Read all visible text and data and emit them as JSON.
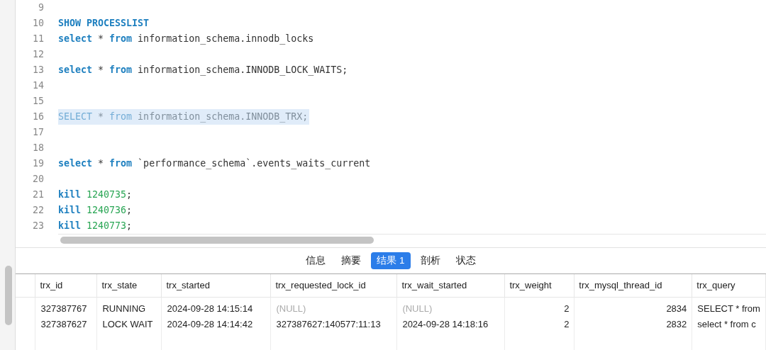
{
  "editor": {
    "lines": [
      {
        "number": "9"
      },
      {
        "number": "10",
        "tokens": [
          {
            "kind": "keyword",
            "text": "SHOW PROCESSLIST"
          }
        ]
      },
      {
        "number": "11",
        "tokens": [
          {
            "kind": "keyword",
            "text": "select"
          },
          {
            "kind": "plain",
            "text": " * "
          },
          {
            "kind": "keyword",
            "text": "from"
          },
          {
            "kind": "plain",
            "text": " information_schema.innodb_locks"
          }
        ]
      },
      {
        "number": "12"
      },
      {
        "number": "13",
        "tokens": [
          {
            "kind": "keyword",
            "text": "select"
          },
          {
            "kind": "plain",
            "text": " * "
          },
          {
            "kind": "keyword",
            "text": "from"
          },
          {
            "kind": "plain",
            "text": " information_schema.INNODB_LOCK_WAITS;"
          }
        ]
      },
      {
        "number": "14"
      },
      {
        "number": "15"
      },
      {
        "number": "16",
        "selected": true,
        "tokens": [
          {
            "kind": "keyword",
            "text": "SELECT"
          },
          {
            "kind": "plain",
            "text": " * "
          },
          {
            "kind": "keyword",
            "text": "from"
          },
          {
            "kind": "plain",
            "text": " information_schema.INNODB_TRX;"
          }
        ]
      },
      {
        "number": "17"
      },
      {
        "number": "18"
      },
      {
        "number": "19",
        "tokens": [
          {
            "kind": "keyword",
            "text": "select"
          },
          {
            "kind": "plain",
            "text": " * "
          },
          {
            "kind": "keyword",
            "text": "from"
          },
          {
            "kind": "plain",
            "text": " `performance_schema`.events_waits_current"
          }
        ]
      },
      {
        "number": "20"
      },
      {
        "number": "21",
        "tokens": [
          {
            "kind": "keyword",
            "text": "kill"
          },
          {
            "kind": "number",
            "text": " 1240735"
          },
          {
            "kind": "plain",
            "text": ";"
          }
        ]
      },
      {
        "number": "22",
        "tokens": [
          {
            "kind": "keyword",
            "text": "kill"
          },
          {
            "kind": "number",
            "text": " 1240736"
          },
          {
            "kind": "plain",
            "text": ";"
          }
        ]
      },
      {
        "number": "23",
        "tokens": [
          {
            "kind": "keyword",
            "text": "kill"
          },
          {
            "kind": "number",
            "text": " 1240773"
          },
          {
            "kind": "plain",
            "text": ";"
          }
        ]
      }
    ]
  },
  "result_tabs": [
    {
      "label": "信息",
      "selected": false
    },
    {
      "label": "摘要",
      "selected": false
    },
    {
      "label": "结果 1",
      "selected": true
    },
    {
      "label": "剖析",
      "selected": false
    },
    {
      "label": "状态",
      "selected": false
    }
  ],
  "table": {
    "columns": [
      {
        "label": "trx_id",
        "kind": "text"
      },
      {
        "label": "trx_state",
        "kind": "text"
      },
      {
        "label": "trx_started",
        "kind": "text"
      },
      {
        "label": "trx_requested_lock_id",
        "kind": "text"
      },
      {
        "label": "trx_wait_started",
        "kind": "text"
      },
      {
        "label": "trx_weight",
        "kind": "number"
      },
      {
        "label": "trx_mysql_thread_id",
        "kind": "number"
      },
      {
        "label": "trx_query",
        "kind": "text"
      }
    ],
    "rows": [
      [
        {
          "text": "327387767"
        },
        {
          "text": "RUNNING"
        },
        {
          "text": "2024-09-28 14:15:14"
        },
        {
          "text": "(NULL)",
          "null": true
        },
        {
          "text": "(NULL)",
          "null": true
        },
        {
          "text": "2"
        },
        {
          "text": "2834"
        },
        {
          "text": "SELECT * from"
        }
      ],
      [
        {
          "text": "327387627"
        },
        {
          "text": "LOCK WAIT"
        },
        {
          "text": "2024-09-28 14:14:42"
        },
        {
          "text": "327387627:140577:11:13"
        },
        {
          "text": "2024-09-28 14:18:16"
        },
        {
          "text": "2"
        },
        {
          "text": "2832"
        },
        {
          "text": "select * from c"
        }
      ]
    ]
  }
}
